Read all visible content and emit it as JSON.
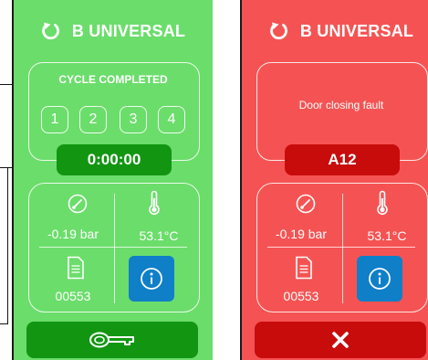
{
  "green_panel": {
    "brand": "B UNIVERSAL",
    "status_label": "CYCLE COMPLETED",
    "steps": [
      "1",
      "2",
      "3",
      "4"
    ],
    "timer": "0:00:00",
    "pressure": "-0.19 bar",
    "temperature": "53.1°C",
    "document_number": "00553",
    "icons": {
      "header": "refresh-icon",
      "pressure": "gauge-icon",
      "temperature": "thermometer-icon",
      "document": "document-icon",
      "info": "info-icon",
      "bottom": "key-icon"
    },
    "colors": {
      "background": "#6bdd6b",
      "dark": "#129612",
      "info": "#0f7fc8"
    }
  },
  "red_panel": {
    "brand": "B UNIVERSAL",
    "fault_text": "Door closing fault",
    "fault_code": "A12",
    "pressure": "-0.19 bar",
    "temperature": "53.1°C",
    "document_number": "00553",
    "icons": {
      "header": "refresh-icon",
      "pressure": "gauge-icon",
      "temperature": "thermometer-icon",
      "document": "document-icon",
      "info": "info-icon",
      "bottom": "close-icon"
    },
    "colors": {
      "background": "#f55353",
      "dark": "#c80c0c",
      "info": "#0f7fc8"
    }
  }
}
